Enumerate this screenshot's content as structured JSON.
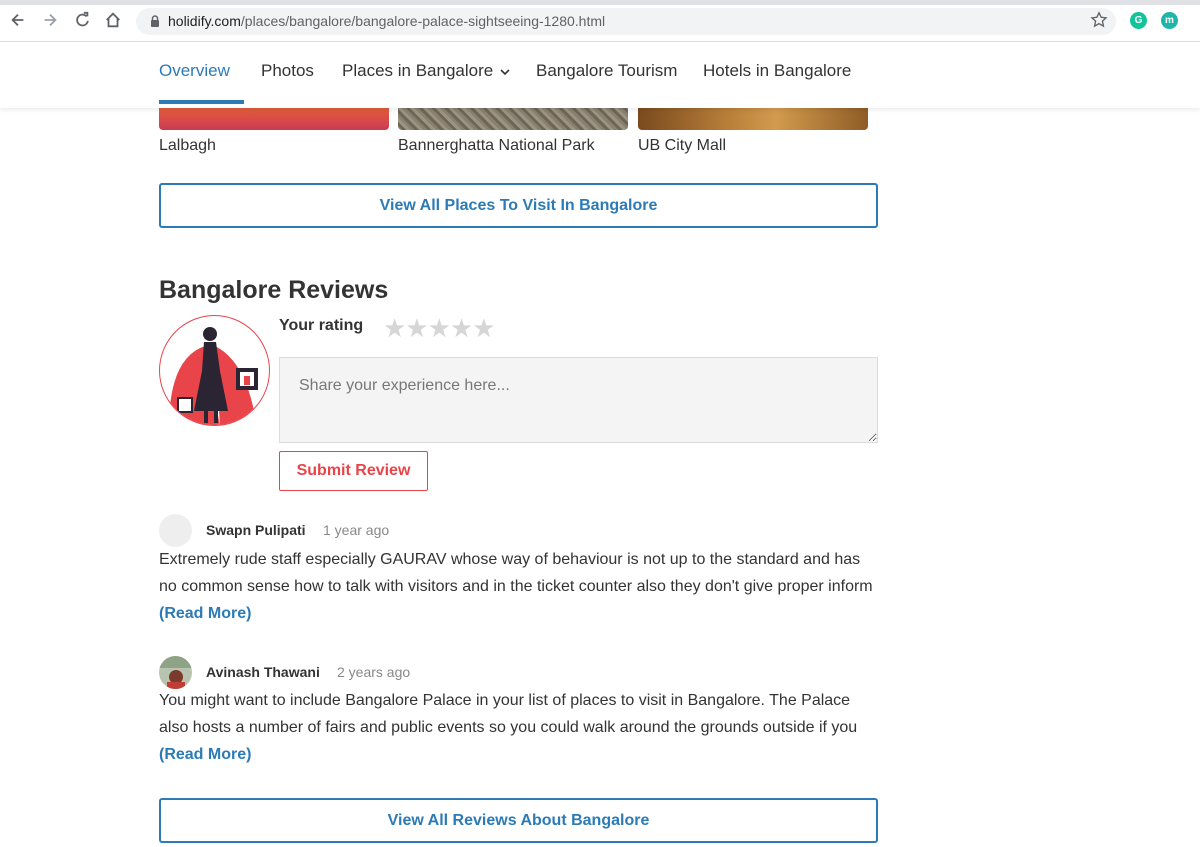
{
  "browser": {
    "url_host": "holidify.com",
    "url_path": "/places/bangalore/bangalore-palace-sightseeing-1280.html",
    "extensions": [
      {
        "name": "grammarly",
        "letter": "G",
        "color": "#15c39a"
      },
      {
        "name": "m-extension",
        "letter": "m",
        "color": "#1fb5a8"
      }
    ]
  },
  "nav": {
    "tabs": [
      {
        "label": "Overview",
        "active": true
      },
      {
        "label": "Photos"
      },
      {
        "label": "Places in Bangalore",
        "dropdown": true
      },
      {
        "label": "Bangalore Tourism"
      },
      {
        "label": "Hotels in Bangalore"
      }
    ]
  },
  "places": [
    {
      "label": "Lalbagh"
    },
    {
      "label": "Bannerghatta National Park"
    },
    {
      "label": "UB City Mall"
    }
  ],
  "view_all_places_label": "View All Places To Visit In Bangalore",
  "reviews": {
    "title": "Bangalore Reviews",
    "rating_label": "Your rating",
    "rating_value": 0,
    "rating_max": 5,
    "stars_display": "★★★★★",
    "placeholder": "Share your experience here...",
    "submit_label": "Submit Review",
    "items": [
      {
        "author": "Swapn Pulipati",
        "time": "1 year ago",
        "text": "Extremely rude staff especially GAURAV whose way of behaviour is not up to the standard and has no common sense how to talk with visitors and in the ticket counter also they don't give proper inform",
        "read_more": "(Read More)"
      },
      {
        "author": "Avinash Thawani",
        "time": "2 years ago",
        "text": "You might want to include Bangalore Palace in your list of places to visit in Bangalore. The Palace also hosts a number of fairs and public events so you could walk around the grounds outside if you",
        "read_more": "(Read More)"
      }
    ],
    "view_all_label": "View All Reviews About Bangalore"
  },
  "colors": {
    "accent_blue": "#2c7bb6",
    "accent_red": "#e8444a"
  }
}
